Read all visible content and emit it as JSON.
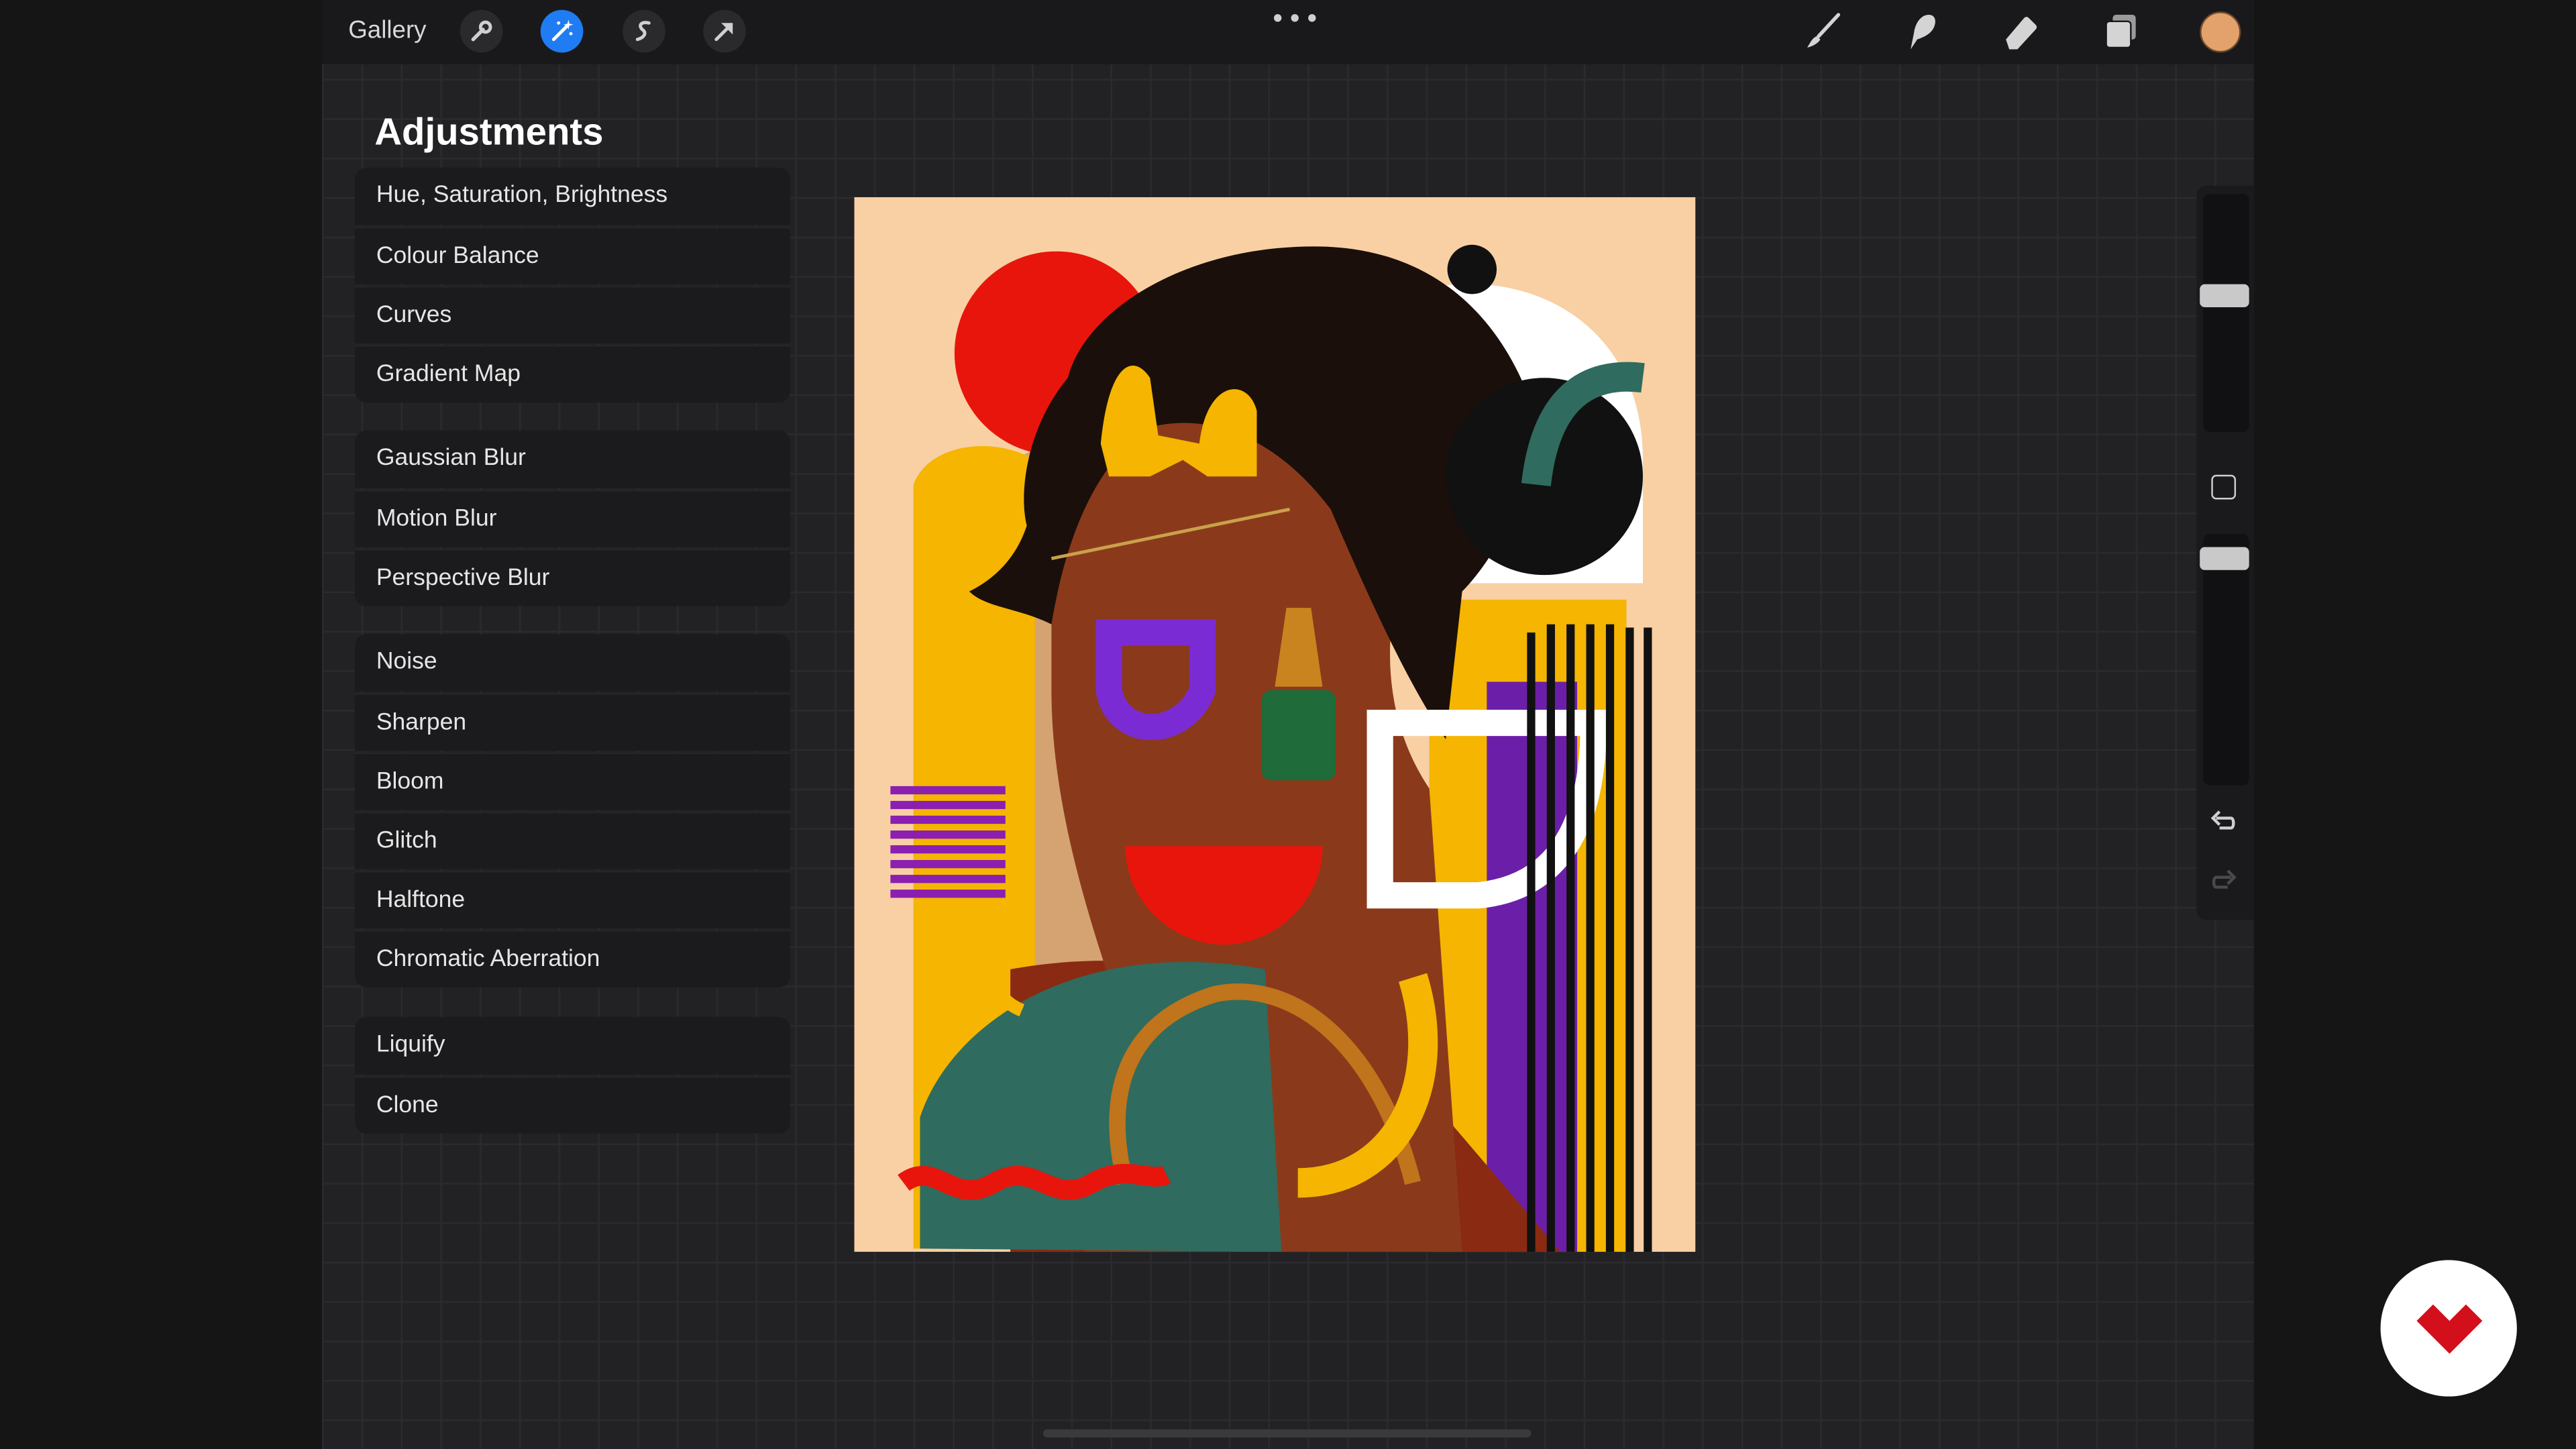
{
  "topbar": {
    "gallery_label": "Gallery",
    "more_dots": "•••"
  },
  "colors": {
    "accent": "#1f7cf2",
    "current_color": "#e3a26c",
    "panel_bg": "#1b1b1d",
    "canvas_bg": "#222225"
  },
  "icons": {
    "left_tools": [
      "wrench-icon",
      "magic-wand-icon",
      "selection-icon",
      "transform-arrow-icon"
    ],
    "right_tools": [
      "brush-icon",
      "smudge-icon",
      "eraser-icon",
      "layers-icon"
    ],
    "sidebar": [
      "square-modify-icon",
      "undo-icon",
      "redo-icon"
    ]
  },
  "adjustments": {
    "title": "Adjustments",
    "groups": [
      [
        "Hue, Saturation, Brightness",
        "Colour Balance",
        "Curves",
        "Gradient Map"
      ],
      [
        "Gaussian Blur",
        "Motion Blur",
        "Perspective Blur"
      ],
      [
        "Noise",
        "Sharpen",
        "Bloom",
        "Glitch",
        "Halftone",
        "Chromatic Aberration"
      ],
      [
        "Liquify",
        "Clone"
      ]
    ]
  }
}
